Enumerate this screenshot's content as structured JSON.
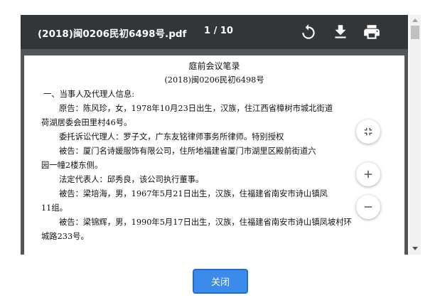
{
  "toolbar": {
    "filename": "(2018)闽0206民初6498号.pdf",
    "page_indicator": "1 / 10"
  },
  "document": {
    "title": "庭前会议笔录",
    "case_no": "(2018)闽0206民初6498号",
    "lines": [
      "一、当事人及代理人信息:",
      "原告：陈风珍，女，1978年10月23日出生，汉族，住江西省樟树市城北街道",
      "荷湖居委会田里村46号。",
      "委托诉讼代理人：罗子文，广东友铭律师事务所律师。特别授权",
      "被告：厦门名诗媛服饰有限公司，住所地福建省厦门市湖里区殿前街道六",
      "园一幢2楼东侧。",
      "法定代表人：邱秀良，该公司执行董事。",
      "被告：梁培海，男，1967年5月21日出生，汉族，住福建省南安市诗山镇凤",
      "11组。",
      "被告：梁锦辉，男，1990年5月17日出生，汉族，住福建省南安市诗山镇凤坡村环",
      "城路233号。"
    ]
  },
  "footer": {
    "close_label": "关闭"
  },
  "colors": {
    "toolbar_bg": "#323639",
    "viewer_bg": "#525659",
    "button_bg": "#3b8beb"
  },
  "icons": {
    "rotate": "rotate-icon",
    "download": "download-icon",
    "print": "print-icon",
    "fit": "fit-page-icon",
    "zoom_in": "zoom-in-icon",
    "zoom_out": "zoom-out-icon"
  }
}
